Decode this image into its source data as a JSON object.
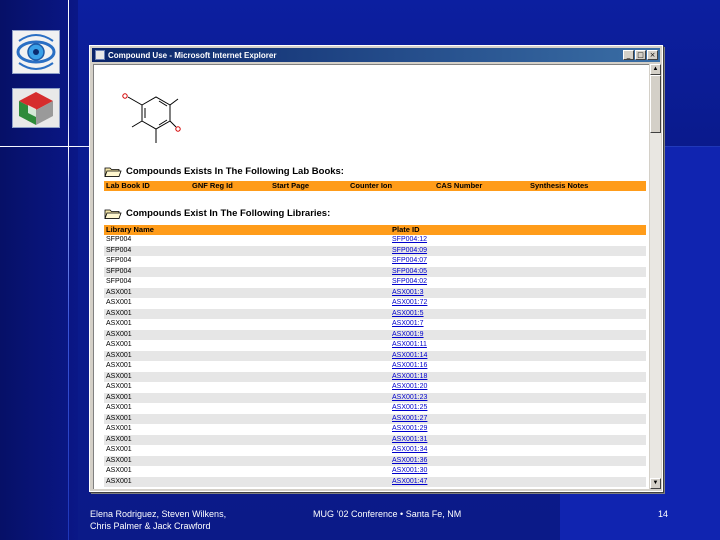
{
  "window": {
    "title": "Compound Use - Microsoft Internet Explorer",
    "buttons": [
      "_",
      "□",
      "×"
    ]
  },
  "lab_books": {
    "heading": "Compounds Exists In The Following Lab Books:",
    "columns": [
      "Lab Book ID",
      "GNF Reg Id",
      "Start Page",
      "Counter Ion",
      "CAS Number",
      "Synthesis Notes"
    ]
  },
  "libraries": {
    "heading": "Compounds Exist In The Following Libraries:",
    "columns": [
      "Library Name",
      "Plate ID"
    ],
    "rows": [
      {
        "name": "SFP004",
        "plate": "SFP004:12"
      },
      {
        "name": "SFP004",
        "plate": "SFP004:09"
      },
      {
        "name": "SFP004",
        "plate": "SFP004:07"
      },
      {
        "name": "SFP004",
        "plate": "SFP004:05"
      },
      {
        "name": "SFP004",
        "plate": "SFP004:02"
      },
      {
        "name": "ASX001",
        "plate": "ASX001:3"
      },
      {
        "name": "ASX001",
        "plate": "ASX001:72"
      },
      {
        "name": "ASX001",
        "plate": "ASX001:5"
      },
      {
        "name": "ASX001",
        "plate": "ASX001:7"
      },
      {
        "name": "ASX001",
        "plate": "ASX001:9"
      },
      {
        "name": "ASX001",
        "plate": "ASX001:11"
      },
      {
        "name": "ASX001",
        "plate": "ASX001:14"
      },
      {
        "name": "ASX001",
        "plate": "ASX001:16"
      },
      {
        "name": "ASX001",
        "plate": "ASX001:18"
      },
      {
        "name": "ASX001",
        "plate": "ASX001:20"
      },
      {
        "name": "ASX001",
        "plate": "ASX001:23"
      },
      {
        "name": "ASX001",
        "plate": "ASX001:25"
      },
      {
        "name": "ASX001",
        "plate": "ASX001:27"
      },
      {
        "name": "ASX001",
        "plate": "ASX001:29"
      },
      {
        "name": "ASX001",
        "plate": "ASX001:31"
      },
      {
        "name": "ASX001",
        "plate": "ASX001:34"
      },
      {
        "name": "ASX001",
        "plate": "ASX001:36"
      },
      {
        "name": "ASX001",
        "plate": "ASX001:30"
      },
      {
        "name": "ASX001",
        "plate": "ASX001:47"
      }
    ]
  },
  "footer": {
    "authors_line1": "Elena Rodriguez, Steven Wilkens,",
    "authors_line2": "Chris Palmer & Jack Crawford",
    "conference": "MUG ’02 Conference • Santa Fe, NM",
    "page_number": "14"
  },
  "colors": {
    "slide_background": "#0a1a8c",
    "table_header": "#ff9c1a",
    "link": "#0000cc"
  }
}
